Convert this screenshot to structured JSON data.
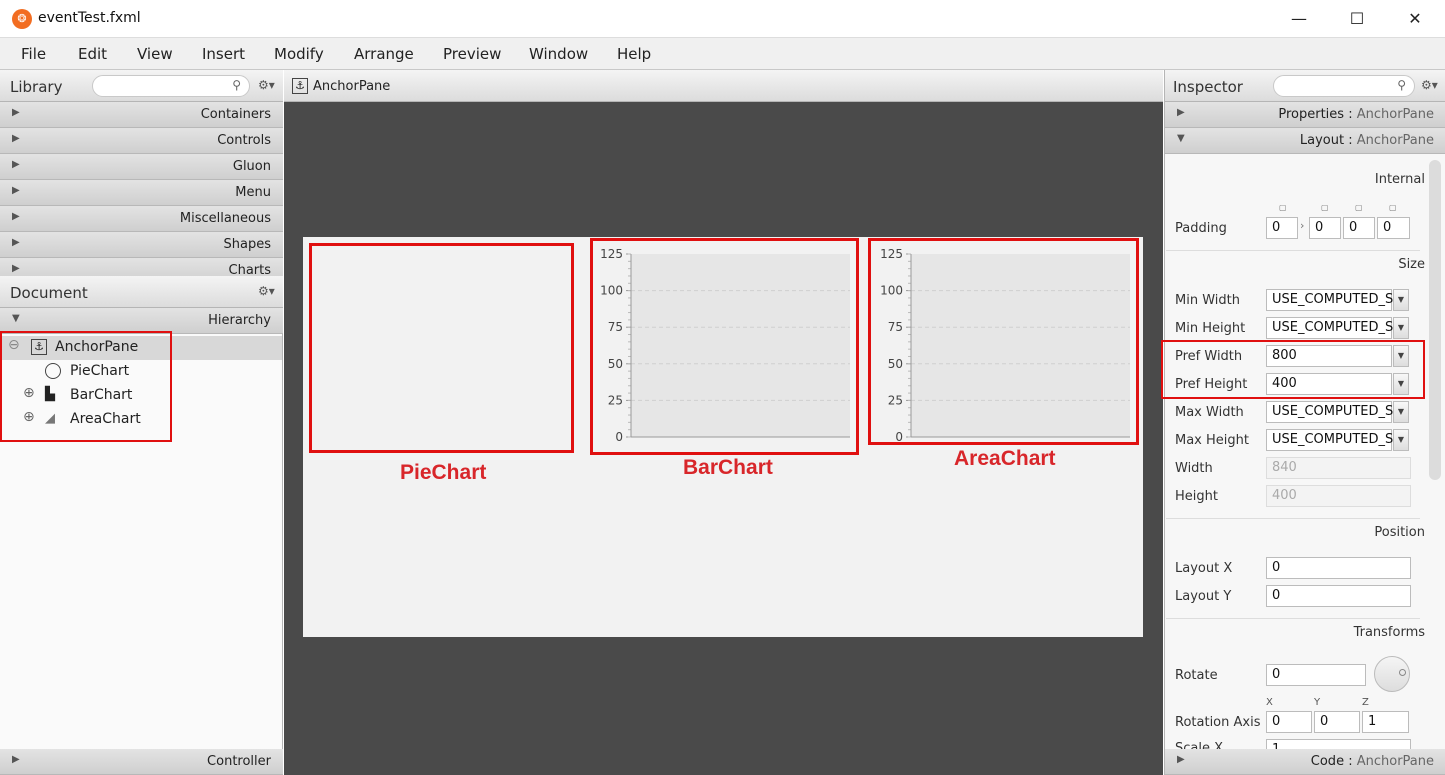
{
  "window": {
    "title": "eventTest.fxml",
    "minimize": "—",
    "maximize": "☐",
    "close": "✕"
  },
  "menu": [
    "File",
    "Edit",
    "View",
    "Insert",
    "Modify",
    "Arrange",
    "Preview",
    "Window",
    "Help"
  ],
  "library": {
    "title": "Library",
    "sections": [
      "Containers",
      "Controls",
      "Gluon",
      "Menu",
      "Miscellaneous",
      "Shapes",
      "Charts"
    ]
  },
  "document": {
    "title": "Document",
    "hierarchy_label": "Hierarchy",
    "tree": [
      {
        "label": "AnchorPane",
        "icon": "anchor-icon",
        "expander": "⊖"
      },
      {
        "label": "PieChart",
        "icon": "pie-chart-icon",
        "expander": ""
      },
      {
        "label": "BarChart",
        "icon": "bar-chart-icon",
        "expander": "⊕"
      },
      {
        "label": "AreaChart",
        "icon": "area-chart-icon",
        "expander": "⊕"
      }
    ],
    "controller_label": "Controller"
  },
  "content": {
    "breadcrumb": "AnchorPane"
  },
  "charts": {
    "y_ticks": [
      "125",
      "100",
      "75",
      "50",
      "25",
      "0"
    ],
    "captions": {
      "pie": "PieChart",
      "bar": "BarChart",
      "area": "AreaChart"
    }
  },
  "inspector": {
    "title": "Inspector",
    "properties": {
      "label": "Properties",
      "target": "AnchorPane"
    },
    "layout": {
      "label": "Layout",
      "target": "AnchorPane"
    },
    "code": {
      "label": "Code",
      "target": "AnchorPane"
    },
    "internal": "Internal",
    "padding_label": "Padding",
    "padding": [
      "0",
      "0",
      "0",
      "0"
    ],
    "size_section": "Size",
    "size_rows": [
      {
        "label": "Min Width",
        "value": "USE_COMPUTED_S",
        "dropdown": true
      },
      {
        "label": "Min Height",
        "value": "USE_COMPUTED_S",
        "dropdown": true
      },
      {
        "label": "Pref Width",
        "value": "800",
        "dropdown": true
      },
      {
        "label": "Pref Height",
        "value": "400",
        "dropdown": true
      },
      {
        "label": "Max Width",
        "value": "USE_COMPUTED_S",
        "dropdown": true
      },
      {
        "label": "Max Height",
        "value": "USE_COMPUTED_S",
        "dropdown": true
      },
      {
        "label": "Width",
        "value": "840",
        "dropdown": false
      },
      {
        "label": "Height",
        "value": "400",
        "dropdown": false
      }
    ],
    "position_section": "Position",
    "layout_x_label": "Layout X",
    "layout_x": "0",
    "layout_y_label": "Layout Y",
    "layout_y": "0",
    "transforms_section": "Transforms",
    "rotate_label": "Rotate",
    "rotate": "0",
    "axis_headers": [
      "X",
      "Y",
      "Z"
    ],
    "rotation_axis_label": "Rotation Axis",
    "rotation_axis": [
      "0",
      "0",
      "1"
    ],
    "scale_x_label": "Scale X",
    "scale_x": "1"
  }
}
